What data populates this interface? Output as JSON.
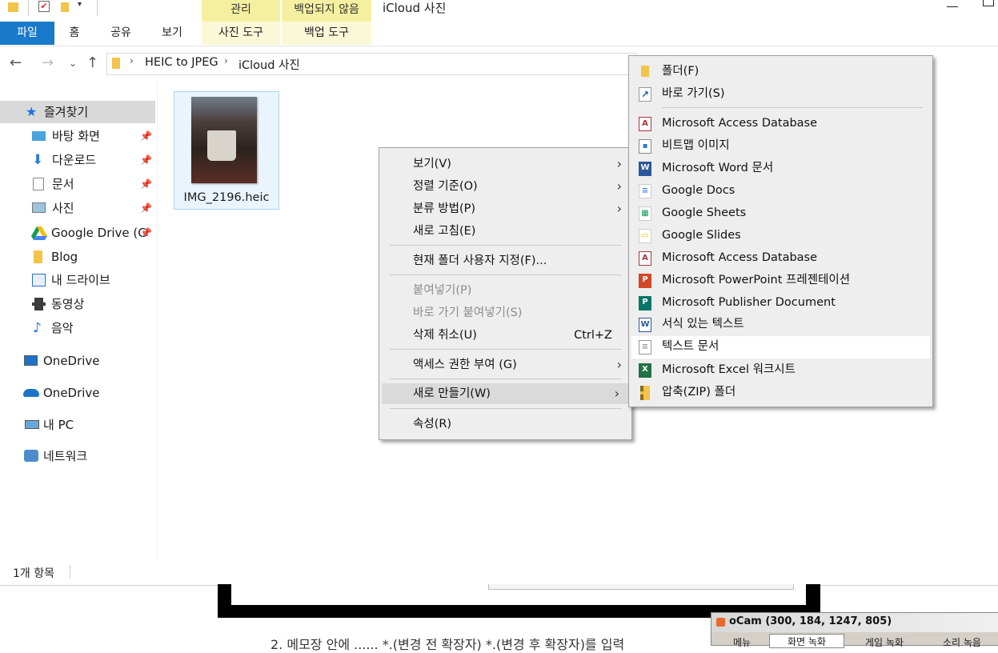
{
  "ribbon": {
    "context_headers": [
      "관리",
      "백업되지 않음"
    ],
    "window_title": "iCloud 사진",
    "tabs": [
      "파일",
      "홈",
      "공유",
      "보기"
    ],
    "context_tabs": [
      "사진 도구",
      "백업 도구"
    ]
  },
  "address": {
    "breadcrumb": [
      "HEIC to JPEG",
      "iCloud 사진"
    ]
  },
  "sidebar": {
    "items": [
      {
        "label": "즐겨찾기",
        "icon": "star-icon"
      },
      {
        "label": "바탕 화면",
        "icon": "desktop-icon"
      },
      {
        "label": "다운로드",
        "icon": "download-icon"
      },
      {
        "label": "문서",
        "icon": "document-icon"
      },
      {
        "label": "사진",
        "icon": "picture-icon"
      },
      {
        "label": "Google Drive (G",
        "icon": "google-drive-icon"
      },
      {
        "label": "Blog",
        "icon": "folder-icon"
      },
      {
        "label": "내 드라이브",
        "icon": "drive-icon"
      },
      {
        "label": "동영상",
        "icon": "video-icon"
      },
      {
        "label": "음악",
        "icon": "music-icon"
      },
      {
        "label": "OneDrive",
        "icon": "onedrive-icon"
      },
      {
        "label": "OneDrive",
        "icon": "cloud-icon"
      },
      {
        "label": "내 PC",
        "icon": "pc-icon"
      },
      {
        "label": "네트워크",
        "icon": "network-icon"
      }
    ]
  },
  "file": {
    "name": "IMG_2196.heic"
  },
  "status": {
    "count": "1개 항목"
  },
  "context_menu": {
    "items": [
      "보기(V)",
      "정렬 기준(O)",
      "분류 방법(P)",
      "새로 고침(E)",
      "현재 폴더 사용자 지정(F)...",
      "붙여넣기(P)",
      "바로 가기 붙여넣기(S)",
      "삭제 취소(U)",
      "액세스 권한 부여 (G)",
      "새로 만들기(W)",
      "속성(R)"
    ],
    "undo_shortcut": "Ctrl+Z"
  },
  "new_submenu": {
    "items": [
      "폴더(F)",
      "바로 가기(S)",
      "Microsoft Access Database",
      "비트맵 이미지",
      "Microsoft Word 문서",
      "Google Docs",
      "Google Sheets",
      "Google Slides",
      "Microsoft Access Database",
      "Microsoft PowerPoint 프레젠테이션",
      "Microsoft Publisher Document",
      "서식 있는 텍스트",
      "텍스트 문서",
      "Microsoft Excel 워크시트",
      "압축(ZIP) 폴더"
    ]
  },
  "ocam": {
    "title": "oCam (300, 184, 1247, 805)",
    "tabs": [
      "메뉴",
      "화면 녹화",
      "게임 녹화",
      "소리 녹음"
    ]
  },
  "background_text": "2. 메모장 안에 ...... *.(변경 전 확장자) *.(변경 후 확장자)를 입력",
  "colors": {
    "accent": "#1979ca",
    "context_header": "#f5f0a0",
    "menu_bg": "#eeeeee"
  }
}
